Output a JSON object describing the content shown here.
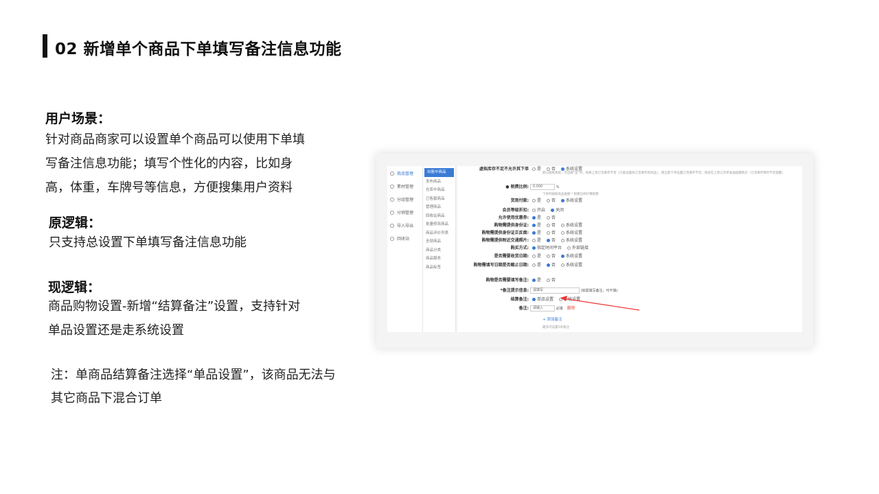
{
  "title": "02 新增单个商品下单填写备注信息功能",
  "user_scene": {
    "heading": "用户场景：",
    "lines": [
      "针对商品商家可以设置单个商品可以使用下单填",
      "写备注信息功能；填写个性化的内容，比如身",
      "高，体重，车牌号等信息，方便搜集用户资料"
    ]
  },
  "old_logic": {
    "heading": "原逻辑：",
    "lines": [
      "只支持总设置下单填写备注信息功能"
    ]
  },
  "new_logic": {
    "heading": "现逻辑：",
    "lines": [
      "商品购物设置-新增“结算备注”设置，支持针对",
      "单品设置还是走系统设置"
    ]
  },
  "note": "注：单商品结算备注选择“单品设置”，该商品无法与其它商品下混合订单",
  "screenshot": {
    "side1": [
      "商品管理",
      "素材管理",
      "分组管理",
      "分销管理",
      "导入导出",
      "回收站"
    ],
    "side2": [
      "出售中商品",
      "发布商品",
      "仓库中商品",
      "已售罄商品",
      "管理商品",
      "回收站商品",
      "批量修改商品",
      "商品评价列表",
      "全部商品",
      "商品分类",
      "商品服务",
      "商品标签"
    ],
    "rows": [
      {
        "label": "虚拟库存不足不允许其下单",
        "opts": [
          "是",
          "否",
          "系统设置"
        ],
        "sel": 2
      },
      {
        "label": "● 税费比例:",
        "input": "0.000",
        "suffix": "%"
      },
      {
        "label": "货到付款:",
        "opts": [
          "是",
          "否",
          "系统设置"
        ],
        "sel": 2
      },
      {
        "label": "会员等级折扣:",
        "opts": [
          "开启",
          "关闭"
        ],
        "sel": 1
      },
      {
        "label": "允许使用优惠券:",
        "opts": [
          "是",
          "否"
        ],
        "sel": 0
      },
      {
        "label": "购物需提供身份证:",
        "opts": [
          "是",
          "否",
          "系统设置"
        ],
        "sel": 0
      },
      {
        "label": "购物需提供身份证正反面:",
        "opts": [
          "是",
          "否",
          "系统设置"
        ],
        "sel": 0
      },
      {
        "label": "购物需提供附近交通照片:",
        "opts": [
          "是",
          "否",
          "系统设置"
        ],
        "sel": 1
      },
      {
        "label": "购买方式:",
        "opts": [
          "指定时间平台",
          "外部链接"
        ],
        "sel": 0
      },
      {
        "label": "是否需要收货日期:",
        "opts": [
          "是",
          "否",
          "系统设置"
        ],
        "sel": 2
      },
      {
        "label": "购物需填写日期是否截止日期:",
        "opts": [
          "是",
          "否",
          "系统设置"
        ],
        "sel": 1
      },
      {
        "label": "购物是否需要填写备注:",
        "opts": [
          "是",
          "否"
        ],
        "sel": 0
      },
      {
        "label": "*备注提示信息:",
        "input": "请填写",
        "suffix": "(如需填写备注，可不填)"
      },
      {
        "label": "结算备注:",
        "opts": [
          "单品设置",
          "系统设置"
        ],
        "sel": 0
      },
      {
        "label": "备注:",
        "input": "请输入",
        "suffix": "必填"
      }
    ],
    "desc_line": "默认按照系统，可选择\"是\"时，如果上架订货库存不足（只能设置有订货库存的商品），则全部下单设置订货库存不足，则会在上架订货单发送提醒购买（订货库存库存不足提醒）",
    "tax_hint": "下单时按照商品金额 * 税费比例计算税费",
    "add_link": "+ 添加备注",
    "add_hint": "最多可设置5条备注",
    "delete": "删除"
  }
}
